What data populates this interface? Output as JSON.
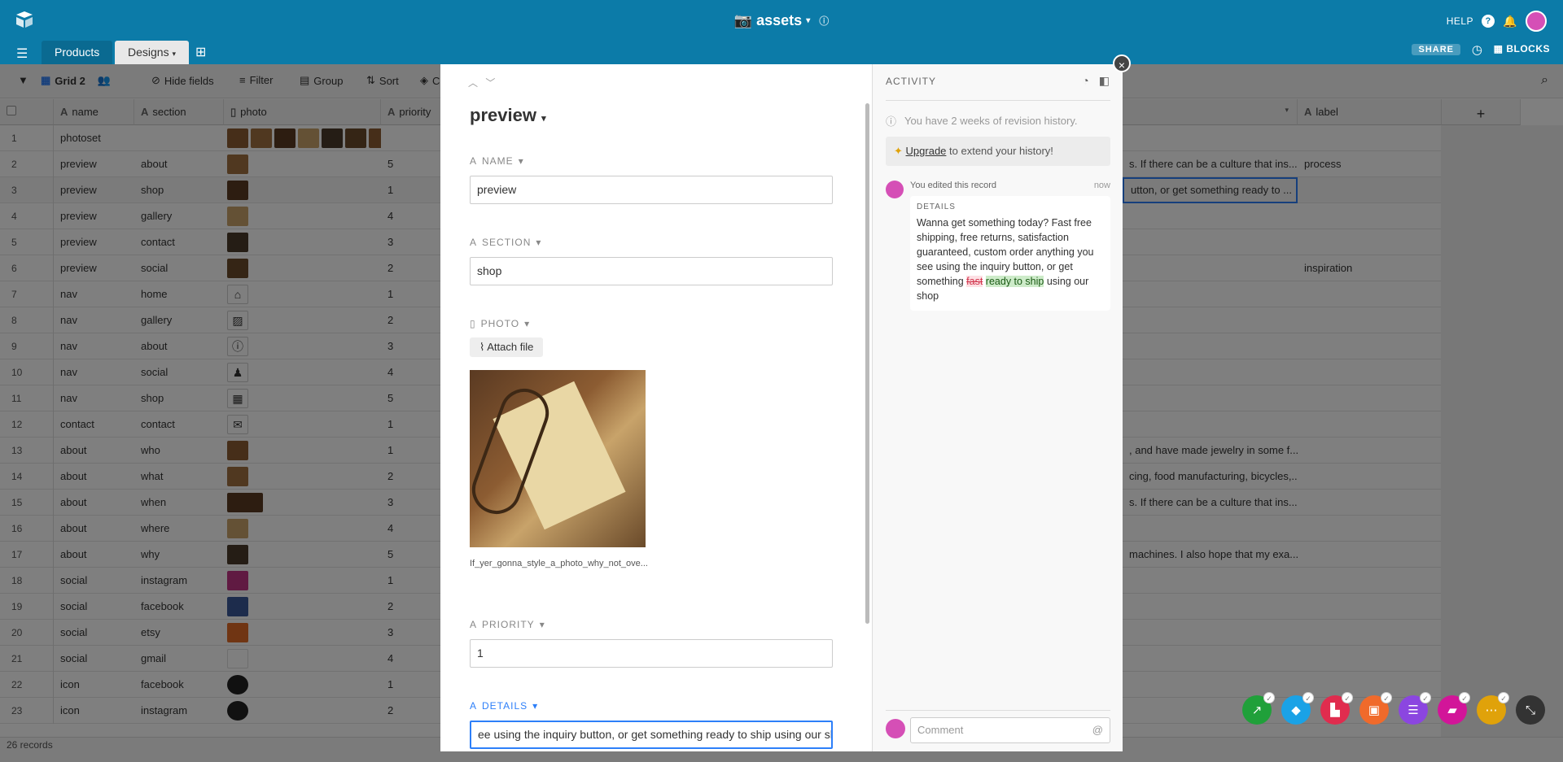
{
  "app": {
    "base_name": "assets"
  },
  "topbar": {
    "help_label": "HELP",
    "help_icon": "?",
    "share_label": "SHARE",
    "blocks_label": "BLOCKS"
  },
  "tabs": [
    {
      "label": "Products"
    },
    {
      "label": "Designs"
    }
  ],
  "toolbar": {
    "view_name": "Grid 2",
    "hide_fields": "Hide fields",
    "filter": "Filter",
    "group": "Group",
    "sort": "Sort",
    "color": "C"
  },
  "columns": {
    "name": "name",
    "section": "section",
    "photo": "photo",
    "priority": "priority",
    "label": "label",
    "add": "+"
  },
  "rows": [
    {
      "num": "1",
      "name": "photoset",
      "section": "",
      "priority": "",
      "details": "",
      "label": ""
    },
    {
      "num": "2",
      "name": "preview",
      "section": "about",
      "priority": "5",
      "details": "s. If there can be a culture that ins...",
      "label": "process"
    },
    {
      "num": "3",
      "name": "preview",
      "section": "shop",
      "priority": "1",
      "details": "utton, or get something ready to ...",
      "label": ""
    },
    {
      "num": "4",
      "name": "preview",
      "section": "gallery",
      "priority": "4",
      "details": "",
      "label": ""
    },
    {
      "num": "5",
      "name": "preview",
      "section": "contact",
      "priority": "3",
      "details": "",
      "label": ""
    },
    {
      "num": "6",
      "name": "preview",
      "section": "social",
      "priority": "2",
      "details": "",
      "label": "inspiration"
    },
    {
      "num": "7",
      "name": "nav",
      "section": "home",
      "priority": "1",
      "details": "",
      "label": ""
    },
    {
      "num": "8",
      "name": "nav",
      "section": "gallery",
      "priority": "2",
      "details": "",
      "label": ""
    },
    {
      "num": "9",
      "name": "nav",
      "section": "about",
      "priority": "3",
      "details": "",
      "label": ""
    },
    {
      "num": "10",
      "name": "nav",
      "section": "social",
      "priority": "4",
      "details": "",
      "label": ""
    },
    {
      "num": "11",
      "name": "nav",
      "section": "shop",
      "priority": "5",
      "details": "",
      "label": ""
    },
    {
      "num": "12",
      "name": "contact",
      "section": "contact",
      "priority": "1",
      "details": "",
      "label": ""
    },
    {
      "num": "13",
      "name": "about",
      "section": "who",
      "priority": "1",
      "details": ", and have made jewelry in some f...",
      "label": ""
    },
    {
      "num": "14",
      "name": "about",
      "section": "what",
      "priority": "2",
      "details": "cing, food manufacturing, bicycles,...",
      "label": ""
    },
    {
      "num": "15",
      "name": "about",
      "section": "when",
      "priority": "3",
      "details": "s. If there can be a culture that ins...",
      "label": ""
    },
    {
      "num": "16",
      "name": "about",
      "section": "where",
      "priority": "4",
      "details": "",
      "label": ""
    },
    {
      "num": "17",
      "name": "about",
      "section": "why",
      "priority": "5",
      "details": "machines. I also hope that my exa...",
      "label": ""
    },
    {
      "num": "18",
      "name": "social",
      "section": "instagram",
      "priority": "1",
      "details": "",
      "label": ""
    },
    {
      "num": "19",
      "name": "social",
      "section": "facebook",
      "priority": "2",
      "details": "",
      "label": ""
    },
    {
      "num": "20",
      "name": "social",
      "section": "etsy",
      "priority": "3",
      "details": "",
      "label": ""
    },
    {
      "num": "21",
      "name": "social",
      "section": "gmail",
      "priority": "4",
      "details": "",
      "label": ""
    },
    {
      "num": "22",
      "name": "icon",
      "section": "facebook",
      "priority": "1",
      "details": "",
      "label": ""
    },
    {
      "num": "23",
      "name": "icon",
      "section": "instagram",
      "priority": "2",
      "details": "",
      "label": ""
    }
  ],
  "footer": {
    "record_count": "26 records"
  },
  "record": {
    "title": "preview",
    "fields": {
      "name_label": "NAME",
      "name_value": "preview",
      "section_label": "SECTION",
      "section_value": "shop",
      "photo_label": "PHOTO",
      "attach_label": "Attach file",
      "photo_filename": "If_yer_gonna_style_a_photo_why_not_ove...",
      "priority_label": "PRIORITY",
      "priority_value": "1",
      "details_label": "DETAILS",
      "details_value": "ee using the inquiry button, or get something ready to ship using our shop"
    }
  },
  "activity": {
    "title": "ACTIVITY",
    "revision_info": "You have 2 weeks of revision history.",
    "upgrade_link": "Upgrade",
    "upgrade_rest": " to extend your history!",
    "edit_author": "You edited this record",
    "edit_time": "now",
    "edit_field": "DETAILS",
    "edit_text_pre": "Wanna get something today? Fast free shipping, free returns, satisfaction guaranteed, custom order anything you see using the inquiry button, or get something ",
    "edit_deleted": "fast",
    "edit_inserted": "ready to ship",
    "edit_text_post": " using our shop",
    "comment_placeholder": "Comment",
    "comment_at": "@"
  },
  "colors": {
    "topbar": "#0c7ba8",
    "accent": "#2d7ff9",
    "avatar": "#d54fb6"
  },
  "block_buttons": [
    {
      "name": "chart-block",
      "color": "#20a03a"
    },
    {
      "name": "diagram-block",
      "color": "#1aa2e6"
    },
    {
      "name": "apps-block",
      "color": "#e02c4e"
    },
    {
      "name": "image-block",
      "color": "#f06a2b"
    },
    {
      "name": "list-block",
      "color": "#8b46e0"
    },
    {
      "name": "chat-block",
      "color": "#d21599"
    },
    {
      "name": "more-block",
      "color": "#e0a20a"
    },
    {
      "name": "minimize-block",
      "color": "#333333"
    }
  ]
}
